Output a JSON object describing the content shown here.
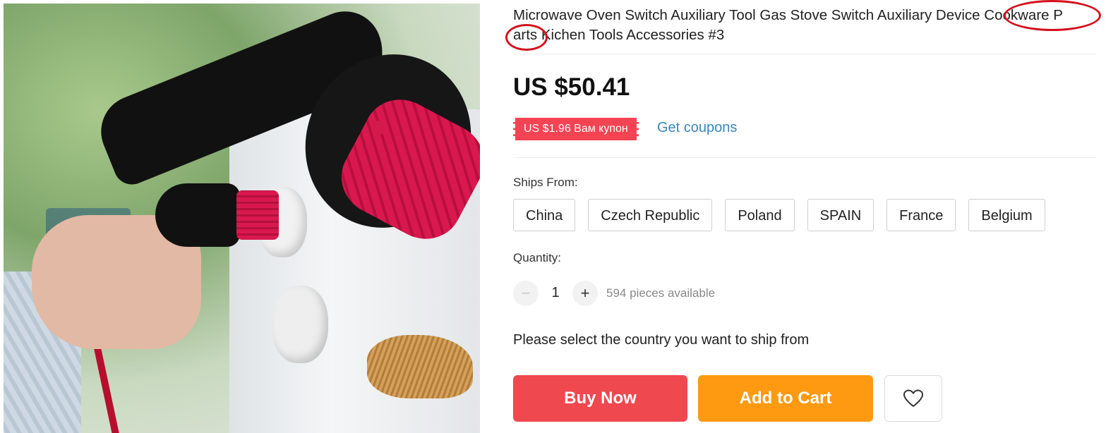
{
  "product": {
    "title_line1": "Microwave Oven Switch Auxiliary Tool Gas Stove Switch Auxiliary Device Cookware P",
    "title_line2": "arts Kichen Tools Accessories #3",
    "price": "US $50.41",
    "coupon_badge": "US $1.96 Вам купон",
    "get_coupons": "Get coupons",
    "ships_from_label": "Ships From:",
    "countries": [
      "China",
      "Czech Republic",
      "Poland",
      "SPAIN",
      "France",
      "Belgium"
    ],
    "quantity_label": "Quantity:",
    "quantity": "1",
    "minus": "−",
    "plus": "+",
    "available": "594 pieces available",
    "select_hint": "Please select the country you want to ship from",
    "buy_now": "Buy Now",
    "add_to_cart": "Add to Cart",
    "wishlist_icon": "heart-icon"
  },
  "colors": {
    "buy_now": "#f0484f",
    "add_to_cart": "#fd9a12",
    "coupon": "#f44352",
    "link": "#3a87b8",
    "annotation_circle": "#d4101c"
  }
}
